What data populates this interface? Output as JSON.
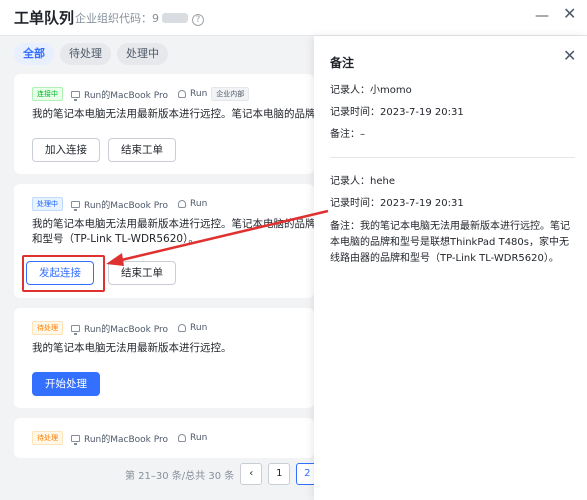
{
  "header": {
    "title": "工单队列",
    "org_label": "企业组织代码：",
    "org_code_prefix": "9",
    "help_icon": "?",
    "minimize_icon": "—",
    "close_icon": "✕"
  },
  "filters": [
    "全部",
    "待处理",
    "处理中"
  ],
  "cards": [
    {
      "status": "连接中",
      "device": "Run的MacBook Pro",
      "user": "Run",
      "extra_tag": "企业内部",
      "description": "我的笔记本电脑无法用最新版本进行远控。笔记本电脑的品牌和型号",
      "buttons": [
        "加入连接",
        "结束工单"
      ]
    },
    {
      "status": "处理中",
      "device": "Run的MacBook Pro",
      "user": "Run",
      "description": "我的笔记本电脑无法用最新版本进行远控。笔记本电脑的品牌和型号（TP-Link TL-WDR5620）。",
      "buttons": [
        "发起连接",
        "结束工单"
      ]
    },
    {
      "status": "待处理",
      "device": "Run的MacBook Pro",
      "user": "Run",
      "description": "我的笔记本电脑无法用最新版本进行远控。",
      "buttons": [
        "开始处理"
      ]
    },
    {
      "status": "待处理",
      "device": "Run的MacBook Pro",
      "user": "Run"
    }
  ],
  "pagination": {
    "summary": "第 21–30 条/总共 30 条",
    "prev": "‹",
    "pages": [
      "1",
      "2"
    ],
    "current": "2"
  },
  "notes_panel": {
    "title": "备注",
    "close_icon": "✕",
    "entries": [
      {
        "recorder": "记录人：小momo",
        "time": "记录时间：2023-7-19 20:31",
        "note": "备注：–"
      },
      {
        "recorder": "记录人：hehe",
        "time": "记录时间：2023-7-19 20:31",
        "note": "备注：我的笔记本电脑无法用最新版本进行远控。笔记本电脑的品牌和型号是联想ThinkPad T480s，家中无线路由器的品牌和型号（TP-Link TL-WDR5620）。"
      }
    ]
  },
  "colors": {
    "accent": "#3370ff",
    "annotation_red": "#e03131"
  }
}
